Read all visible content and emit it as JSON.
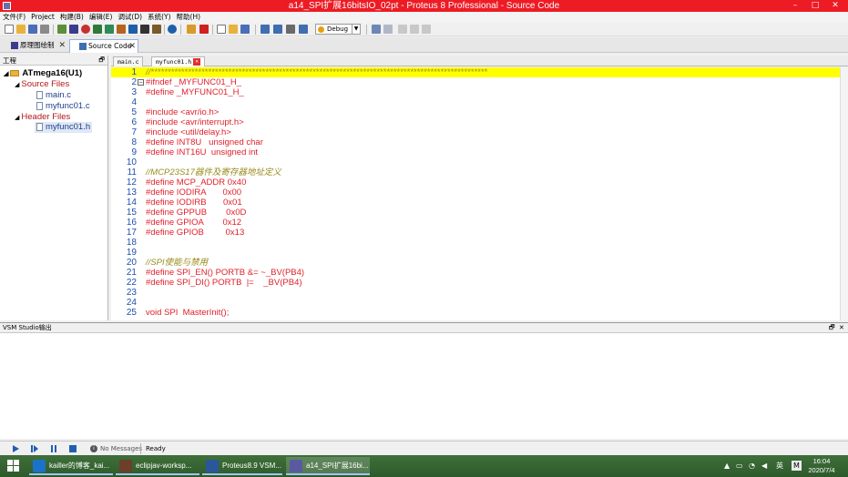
{
  "window": {
    "title": "a14_SPI扩展16bitsIO_02pt - Proteus 8 Professional - Source Code",
    "controls": [
      "–",
      "□",
      "✕"
    ]
  },
  "menu": [
    "文件(F)",
    "Project",
    "构建(B)",
    "编辑(E)",
    "调试(D)",
    "系统(Y)",
    "帮助(H)"
  ],
  "toolbar": {
    "build_config": "Debug"
  },
  "doc_tabs": [
    {
      "label": "原理图绘制",
      "active": false
    },
    {
      "label": "Source Code",
      "active": true
    }
  ],
  "project_panel": {
    "title": "工程",
    "tree": [
      {
        "label": "ATmega16(U1)",
        "type": "root"
      },
      {
        "label": "Source Files",
        "type": "folder"
      },
      {
        "label": "main.c",
        "type": "file"
      },
      {
        "label": "myfunc01.c",
        "type": "file"
      },
      {
        "label": "Header Files",
        "type": "folder"
      },
      {
        "label": "myfunc01.h",
        "type": "file"
      }
    ]
  },
  "editor_tabs": [
    {
      "label": "main.c",
      "active": false
    },
    {
      "label": "myfunc01.h",
      "active": true
    }
  ],
  "code_lines": [
    {
      "n": "1",
      "text": "//****************************************************************************************************",
      "kind": "comment",
      "highlight": true
    },
    {
      "n": "2",
      "text": "#ifndef _MYFUNC01_H_",
      "kind": "code",
      "fold": "⊟"
    },
    {
      "n": "3",
      "text": "#define _MYFUNC01_H_",
      "kind": "code"
    },
    {
      "n": "4",
      "text": "",
      "kind": "code"
    },
    {
      "n": "5",
      "text": "#include <avr/io.h>",
      "kind": "code"
    },
    {
      "n": "6",
      "text": "#include <avr/interrupt.h>",
      "kind": "code"
    },
    {
      "n": "7",
      "text": "#include <util/delay.h>",
      "kind": "code"
    },
    {
      "n": "8",
      "text": "#define INT8U   unsigned char",
      "kind": "code"
    },
    {
      "n": "9",
      "text": "#define INT16U  unsigned int",
      "kind": "code"
    },
    {
      "n": "10",
      "text": "",
      "kind": "code"
    },
    {
      "n": "11",
      "text": "//MCP23S17器件及寄存器地址定义",
      "kind": "comment"
    },
    {
      "n": "12",
      "text": "#define MCP_ADDR 0x40",
      "kind": "code"
    },
    {
      "n": "13",
      "text": "#define IODIRA       0x00",
      "kind": "code"
    },
    {
      "n": "14",
      "text": "#define IODIRB       0x01",
      "kind": "code"
    },
    {
      "n": "15",
      "text": "#define GPPUB        0x0D",
      "kind": "code"
    },
    {
      "n": "16",
      "text": "#define GPIOA        0x12",
      "kind": "code"
    },
    {
      "n": "17",
      "text": "#define GPIOB         0x13",
      "kind": "code"
    },
    {
      "n": "18",
      "text": "",
      "kind": "code"
    },
    {
      "n": "19",
      "text": "",
      "kind": "code"
    },
    {
      "n": "20",
      "text": "//SPI使能与禁用",
      "kind": "comment"
    },
    {
      "n": "21",
      "text": "#define SPI_EN() PORTB &= ~_BV(PB4)",
      "kind": "code"
    },
    {
      "n": "22",
      "text": "#define SPI_DI() PORTB  |=    _BV(PB4)",
      "kind": "code"
    },
    {
      "n": "23",
      "text": "",
      "kind": "code"
    },
    {
      "n": "24",
      "text": "",
      "kind": "code"
    },
    {
      "n": "25",
      "text": "void SPI  MasterInit();",
      "kind": "code"
    }
  ],
  "output_panel": {
    "title": "VSM Studio输出"
  },
  "status": {
    "messages": "No Messages",
    "ready": "Ready"
  },
  "taskbar": {
    "tasks": [
      {
        "label": "kailler的博客_kai...",
        "color": "#1a73c8",
        "active": false
      },
      {
        "label": "eclipjav-worksp...",
        "color": "#6b3f2a",
        "active": false
      },
      {
        "label": "Proteus8.9 VSM...",
        "color": "#2b579a",
        "active": false
      },
      {
        "label": "a14_SPI扩展16bi...",
        "color": "#5a5aa0",
        "active": true
      }
    ],
    "tray_lang": "英",
    "tray_m": "M",
    "clock_time": "16:04",
    "clock_date": "2020/7/4"
  },
  "colors": {
    "titlebar": "#ed1b24",
    "code_text": "#e0202a",
    "comment_text": "#9a8c1c",
    "line_number": "#1d4faa",
    "highlight_line": "#ffff00",
    "taskbar": "#2d5a2a"
  }
}
